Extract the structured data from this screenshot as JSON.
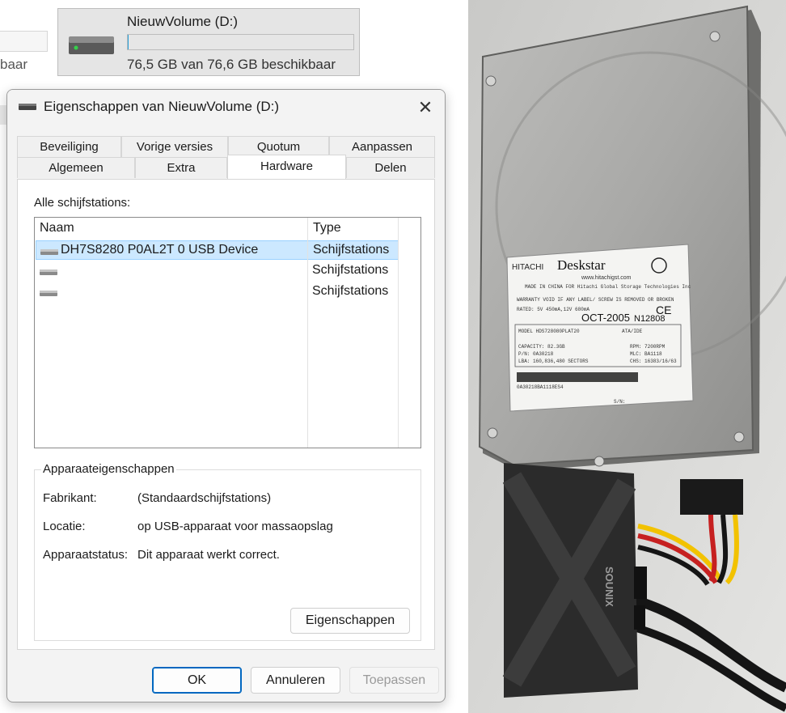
{
  "drive_tile": {
    "name": "NieuwVolume (D:)",
    "free_text": "76,5 GB van 76,6 GB beschikbaar",
    "used_fraction": 0.002
  },
  "background_text": {
    "fragment": "baar"
  },
  "dialog": {
    "title": "Eigenschappen van NieuwVolume (D:)",
    "close_glyph": "✕",
    "tabs_row1": [
      "Beveiliging",
      "Vorige versies",
      "Quotum",
      "Aanpassen"
    ],
    "tabs_row2": [
      "Algemeen",
      "Extra",
      "Hardware",
      "Delen"
    ],
    "active_tab": "Hardware",
    "all_drives_label": "Alle schijfstations:",
    "columns": [
      "Naam",
      "Type"
    ],
    "rows": [
      {
        "name": "DH7S8280 P0AL2T 0 USB Device",
        "type": "Schijfstations",
        "selected": true
      },
      {
        "name": "",
        "type": "Schijfstations",
        "selected": false
      },
      {
        "name": "",
        "type": "Schijfstations",
        "selected": false
      }
    ],
    "device_properties": {
      "title": "Apparaateigenschappen",
      "manufacturer_label": "Fabrikant:",
      "manufacturer_value": "(Standaardschijfstations)",
      "location_label": "Locatie:",
      "location_value": "op USB-apparaat voor massaopslag",
      "status_label": "Apparaatstatus:",
      "status_value": "Dit apparaat werkt correct.",
      "properties_button": "Eigenschappen"
    },
    "buttons": {
      "ok": "OK",
      "cancel": "Annuleren",
      "apply": "Toepassen"
    }
  },
  "photo": {
    "label_brand": "HITACHI",
    "label_model": "Deskstar",
    "label_site": "www.hitachigst.com",
    "label_made_in": "MADE IN CHINA FOR Hitachi Global Storage Technologies Inc",
    "label_warranty": "WARRANTY VOID IF ANY LABEL/ SCREW IS REMOVED OR BROKEN",
    "label_rated": "RATED: 5V 450mA,12V 680mA",
    "label_date": "OCT-2005",
    "label_serial_code": "N12808",
    "label_model_line": "MODEL HDS728080PLAT20",
    "label_interface": "ATA/IDE",
    "label_capacity": "CAPACITY: 82.3GB",
    "label_rpm": "RPM: 7200RPM",
    "label_pn": "P/N: 0A30218",
    "label_mlc": "MLC: BA1118",
    "label_lba": "LBA: 160,836,480 SECTORS",
    "label_chs": "CHS: 16383/16/63",
    "label_barcode_text": "0A30218BA1118ES4",
    "label_sn": "S/N:",
    "adapter_brand": "SOUNIX"
  },
  "colors": {
    "accent": "#0067c0",
    "selection": "#cce8ff",
    "drive_bar_fill": "#26a0da",
    "adapter": "#2b2b2b",
    "wire_yellow": "#f2c200",
    "wire_red": "#c62020",
    "wire_black": "#151515"
  },
  "icons": [
    "drive-icon",
    "dialog-drive-icon",
    "close-icon",
    "device-drive-icon"
  ]
}
